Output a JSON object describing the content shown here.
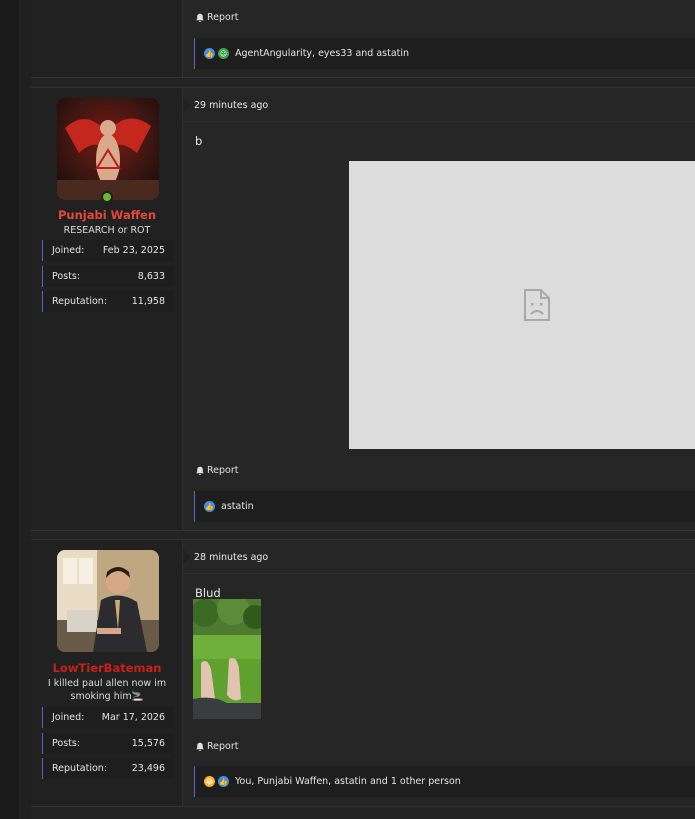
{
  "posts": [
    {
      "report_label": "Report",
      "reactors": "AgentAngularity, eyes33 and astatin"
    },
    {
      "timestamp": "29 minutes ago",
      "username": "Punjabi Waffen",
      "user_title": "RESEARCH or ROT",
      "stats": {
        "joined_label": "Joined:",
        "joined_value": "Feb 23, 2025",
        "posts_label": "Posts:",
        "posts_value": "8,633",
        "reputation_label": "Reputation:",
        "reputation_value": "11,958"
      },
      "body": "b",
      "report_label": "Report",
      "reactors": "astatin"
    },
    {
      "timestamp": "28 minutes ago",
      "username": "LowTierBateman",
      "user_title": "I killed paul allen now im smoking him🚬",
      "stats": {
        "joined_label": "Joined:",
        "joined_value": "Mar 17, 2026",
        "posts_label": "Posts:",
        "posts_value": "15,576",
        "reputation_label": "Reputation:",
        "reputation_value": "23,496"
      },
      "body": "Blud",
      "report_label": "Report",
      "reactors": "You, Punjabi Waffen, astatin and 1 other person"
    }
  ],
  "colors": {
    "username_1": "#e8463a",
    "username_2": "#c8211b",
    "accent_border": "#5a66c9",
    "online": "#6cbb2c"
  },
  "icons": [
    "bell-icon",
    "like-reaction-icon",
    "green-reaction-icon",
    "laugh-reaction-icon",
    "broken-image-icon"
  ]
}
